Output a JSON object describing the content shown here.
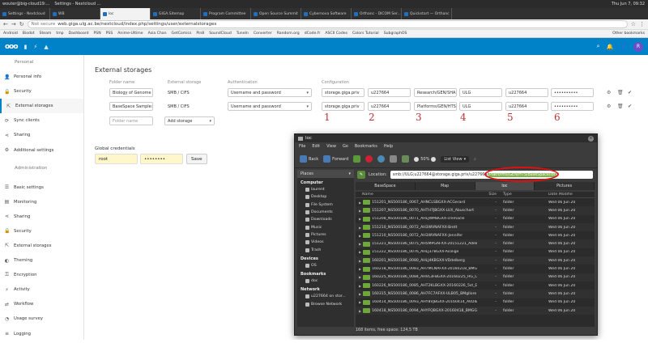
{
  "top_bar": {
    "user": "wouter@big-cloud19:...",
    "title": "Settings - Nextcloud ...",
    "clock": "Thu Jun 7, 09:32"
  },
  "browser_tabs": [
    {
      "label": "Settings - Nextcloud",
      "active": false
    },
    {
      "label": "WB",
      "active": false
    },
    {
      "label": "loc",
      "active": true
    },
    {
      "label": "GIGA.Sitemap",
      "active": false
    },
    {
      "label": "Program Committee",
      "active": false
    },
    {
      "label": "Open Source Summit",
      "active": false
    },
    {
      "label": "Cybernova Software",
      "active": false
    },
    {
      "label": "Orthanc - DICOM Ser...",
      "active": false
    },
    {
      "label": "Quickstart — Orthanc",
      "active": false
    }
  ],
  "address": {
    "security": "Not secure",
    "url": "web.giga.ulg.ac.be/nextcloud/index.php/settings/user/externalstorages"
  },
  "bookmarks": [
    "Android",
    "Biodot",
    "Steam",
    "tmp",
    "Dashboard",
    "PSN",
    "PSS",
    "Anime-Ultime",
    "Asia Chan",
    "GetComics",
    "Pin8",
    "SoundCloud",
    "TuneIn",
    "Converter",
    "Random.org",
    "dCode.fr",
    "ASCII Codes",
    "Colors Tutorial",
    "SubgraphOS"
  ],
  "bookmarks_other": "Other bookmarks",
  "nc": {
    "logo": "ooo",
    "avatar_letter": "R"
  },
  "sidebar": {
    "personal_heading": "Personal",
    "personal_items": [
      {
        "label": "Personal info",
        "icon": "person-icon",
        "active": false
      },
      {
        "label": "Security",
        "icon": "lock-icon",
        "active": false
      },
      {
        "label": "External storages",
        "icon": "external-icon",
        "active": true
      },
      {
        "label": "Sync clients",
        "icon": "sync-icon",
        "active": false
      },
      {
        "label": "Sharing",
        "icon": "share-icon",
        "active": false
      },
      {
        "label": "Additional settings",
        "icon": "gear-icon",
        "active": false
      }
    ],
    "admin_heading": "Administration",
    "admin_items": [
      {
        "label": "Basic settings",
        "icon": "sliders-icon"
      },
      {
        "label": "Monitoring",
        "icon": "monitor-icon"
      },
      {
        "label": "Sharing",
        "icon": "share-icon"
      },
      {
        "label": "Security",
        "icon": "lock-icon"
      },
      {
        "label": "External storages",
        "icon": "external-icon"
      },
      {
        "label": "Theming",
        "icon": "theming-icon"
      },
      {
        "label": "Encryption",
        "icon": "key-icon"
      },
      {
        "label": "Activity",
        "icon": "activity-icon"
      },
      {
        "label": "Workflow",
        "icon": "workflow-icon"
      },
      {
        "label": "Usage survey",
        "icon": "survey-icon"
      },
      {
        "label": "Logging",
        "icon": "log-icon"
      },
      {
        "label": "Additional settings",
        "icon": "gear-icon"
      }
    ]
  },
  "external_storage": {
    "heading": "External storages",
    "columns": {
      "folder": "Folder name",
      "storage": "External storage",
      "auth": "Authentication",
      "config": "Configuration"
    },
    "rows": [
      {
        "folder": "Biology of Genome",
        "storage": "SMB / CIFS",
        "auth": "Username and password",
        "host": "storage.giga.priv",
        "share": "u227664",
        "remote": "Research/GEN/SHA",
        "domain": "ULG",
        "user": "u227664",
        "password": "••••••••••"
      },
      {
        "folder": "BaseSpace Sample:",
        "storage": "SMB / CIFS",
        "auth": "Username and password",
        "host": "storage.giga.priv",
        "share": "u227664",
        "remote": "Platforms/GEN/HTS",
        "domain": "ULG",
        "user": "u227664",
        "password": "••••••••••"
      }
    ],
    "new_folder_placeholder": "Folder name",
    "add_storage": "Add storage",
    "annotations": [
      "1",
      "2",
      "3",
      "4",
      "5",
      "6"
    ]
  },
  "global_credentials": {
    "label": "Global credentials",
    "user": "root",
    "password": "••••••••",
    "save": "Save"
  },
  "file_manager": {
    "title": "loc",
    "menu": [
      "File",
      "Edit",
      "View",
      "Go",
      "Bookmarks",
      "Help"
    ],
    "toolbar": {
      "back": "Back",
      "forward": "Forward",
      "zoom": "50%",
      "view": "List View"
    },
    "places_label": "Places",
    "groups": {
      "computer": "Computer",
      "devices": "Devices",
      "bookmarks": "Bookmarks",
      "network": "Network"
    },
    "computer_places": [
      "laurent",
      "Desktop",
      "File System",
      "Documents",
      "Downloads",
      "Music",
      "Pictures",
      "Videos",
      "Trash"
    ],
    "device_places": [
      "OS"
    ],
    "bookmark_places": [
      "doc"
    ],
    "network_places": [
      "u227664 on stor...",
      "Browse Network"
    ],
    "location_label": "Location:",
    "location_prefix": "smb://ULG;u227664@storage.giga.priv/u227664/",
    "location_highlight": "Platforms/GEN/HTS/BaseSpace/loc",
    "tabs": [
      {
        "label": "BaseSpace",
        "active": false
      },
      {
        "label": "Map",
        "active": false
      },
      {
        "label": "loc",
        "active": true
      },
      {
        "label": "Pictures",
        "active": false
      }
    ],
    "columns": {
      "name": "Name",
      "size": "Size",
      "type": "Type",
      "date": "Date Modifie"
    },
    "rows": [
      {
        "name": "151201_NS500186_0067_AHNCLSBGXX-ACGerard",
        "size": "-",
        "type": "folder",
        "date": "Wed 06 Jun 20"
      },
      {
        "name": "151207_NS500186_0070_AHTH7JBGXX-LUX_Abuschart",
        "size": "-",
        "type": "folder",
        "date": "Wed 06 Jun 20"
      },
      {
        "name": "151208_NS500186_0071_AHLJWMBGXX-cremacle",
        "size": "-",
        "type": "folder",
        "date": "Wed 06 Jun 20"
      },
      {
        "name": "151210_NS500186_0072_AH3WVNAFXX-Brett",
        "size": "-",
        "type": "folder",
        "date": "Wed 06 Jun 20"
      },
      {
        "name": "151210_NS500186_0072_AH3WVNAFXX-Jennifer",
        "size": "-",
        "type": "folder",
        "date": "Wed 06 Jun 20"
      },
      {
        "name": "151221_NS500186_0075_AH5MPGAFXX-20151221_Adeline",
        "size": "-",
        "type": "folder",
        "date": "Wed 06 Jun 20"
      },
      {
        "name": "151222_NS500186_0076_AHLJ37BGXX-Acolige",
        "size": "-",
        "type": "folder",
        "date": "Wed 06 Jun 20"
      },
      {
        "name": "160201_NS500186_0080_AHLJ4KBGXX-VDdelberg",
        "size": "-",
        "type": "folder",
        "date": "Wed 06 Jun 20"
      },
      {
        "name": "160218_NS500186_0083_AH7MCNAFXX-20160218_BMGG",
        "size": "-",
        "type": "folder",
        "date": "Wed 06 Jun 20"
      },
      {
        "name": "160225_NS500186_0084_AHVL3FBGXX-20160225_HG_Co...",
        "size": "-",
        "type": "folder",
        "date": "Wed 06 Jun 20"
      },
      {
        "name": "160226_NS500186_0085_AHT2KLBGXX-20160226_5st_Epi",
        "size": "-",
        "type": "folder",
        "date": "Wed 06 Jun 20"
      },
      {
        "name": "160315_NS500186_0086_AH7FC7AFXX-ULB05_BMglIore",
        "size": "-",
        "type": "folder",
        "date": "Wed 06 Jun 20"
      },
      {
        "name": "160414_NS500186_0093_AHY8VJBGXX-20160414_AVDIB",
        "size": "-",
        "type": "folder",
        "date": "Wed 06 Jun 20"
      },
      {
        "name": "160418_NS500186_0094_AHYFQBGXX-20160418_BMGG",
        "size": "-",
        "type": "folder",
        "date": "Wed 06 Jun 20"
      }
    ],
    "status": "168 items, free space: 124,5 TB"
  }
}
